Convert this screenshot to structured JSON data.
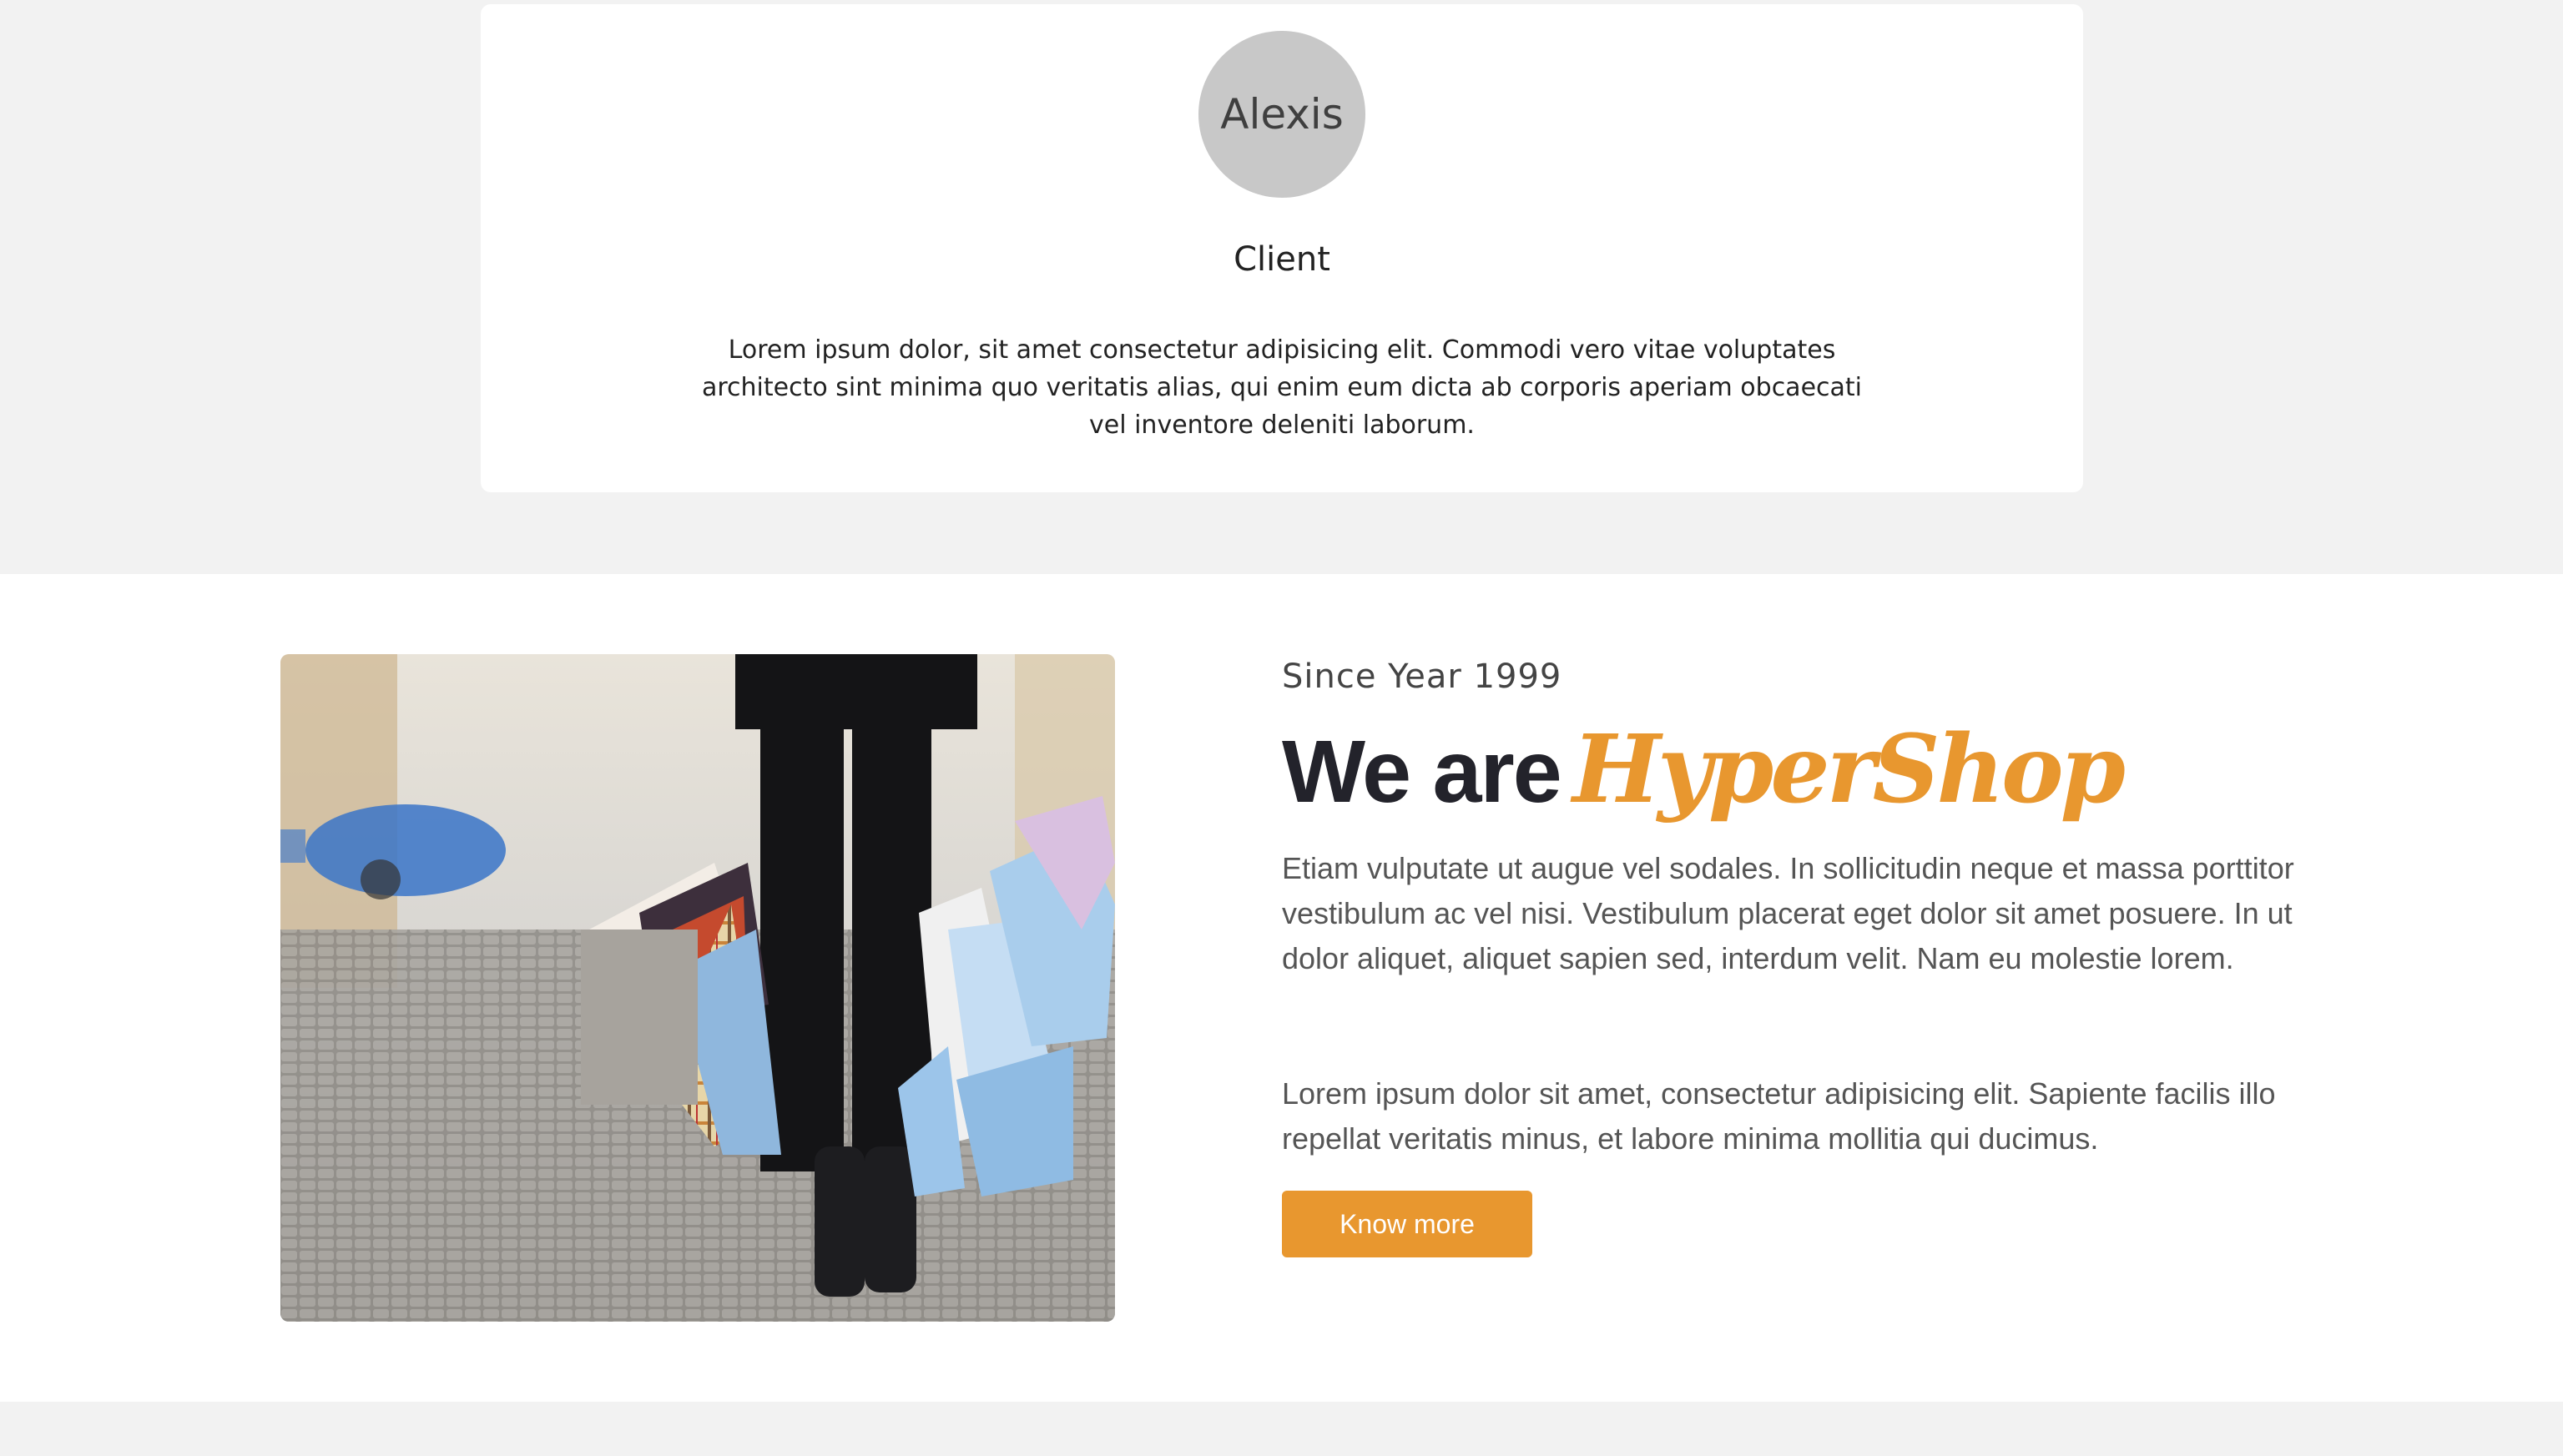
{
  "testimonial": {
    "avatar_text": "Alexis",
    "role": "Client",
    "quote": "Lorem ipsum dolor, sit amet consectetur adipisicing elit. Commodi vero vitae voluptates architecto sint minima quo veritatis alias, qui enim eum dicta ab corporis aperiam obcaecati vel inventore deleniti laborum."
  },
  "about": {
    "since": "Since Year 1999",
    "heading_prefix": "We are",
    "brand": "HyperShop",
    "paragraph_1": "Etiam vulputate ut augue vel sodales. In sollicitudin neque et massa porttitor vestibulum ac vel nisi. Vestibulum placerat eget dolor sit amet posuere. In ut dolor aliquet, aliquet sapien sed, interdum velit. Nam eu molestie lorem.",
    "paragraph_2": "Lorem ipsum dolor sit amet, consectetur adipisicing elit. Sapiente facilis illo repellat veritatis minus, et labore minima mollitia qui ducimus.",
    "cta_label": "Know more"
  },
  "colors": {
    "accent": "#e8972f",
    "heading": "#23232b",
    "page_bg": "#f2f2f2"
  }
}
